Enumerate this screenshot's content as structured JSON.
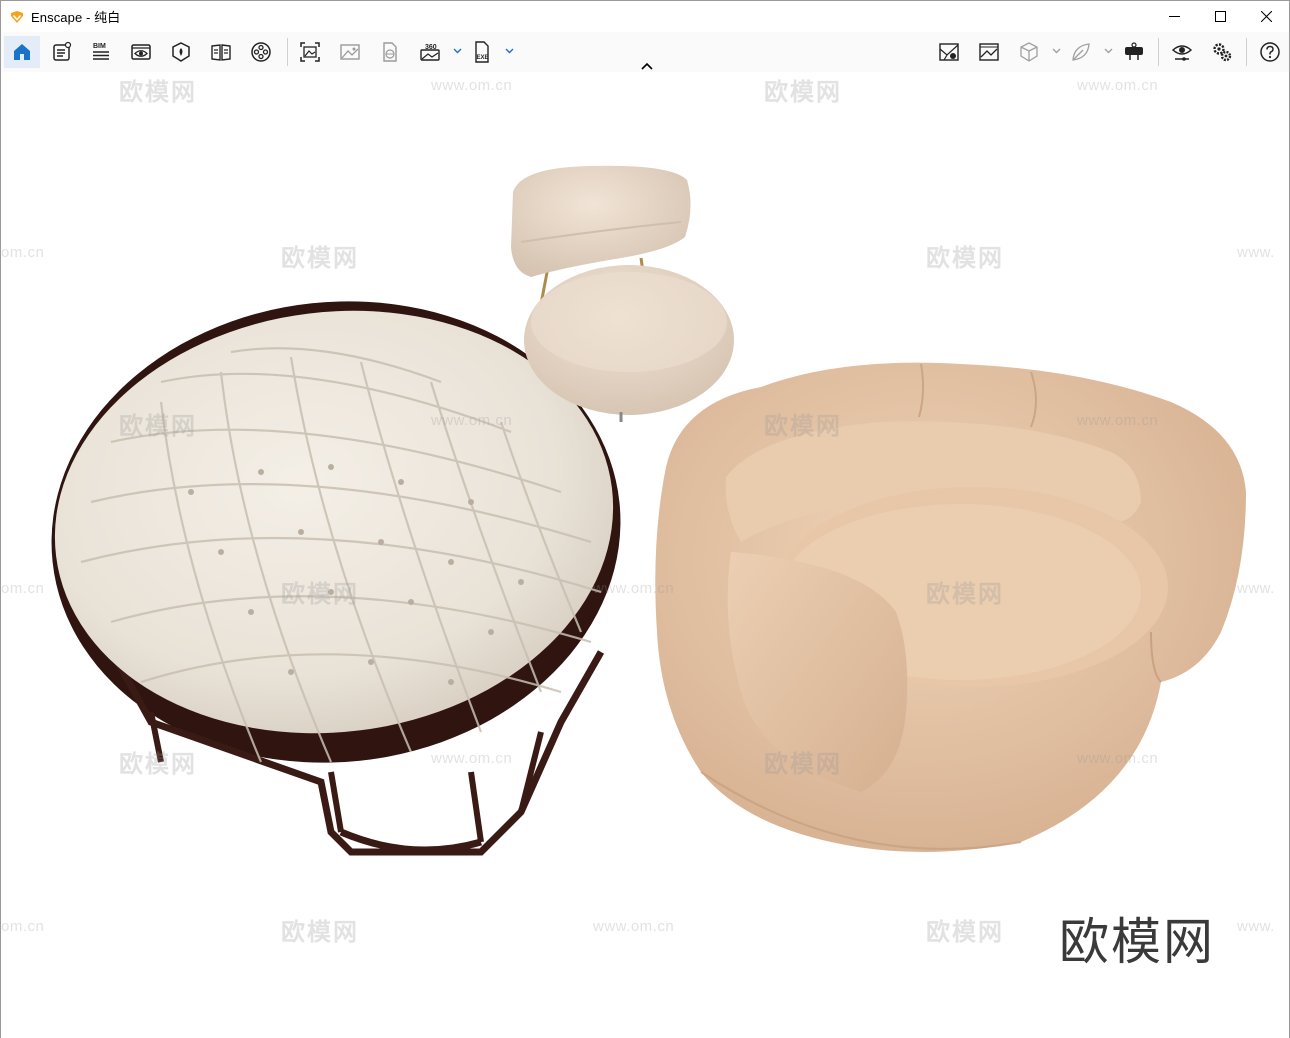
{
  "window": {
    "title": "Enscape - 纯白"
  },
  "toolbar": {
    "bim_label": "BIM",
    "pano_label": "360",
    "exe_label": "EXE"
  },
  "watermark": {
    "brand": "欧模网",
    "url": "www.om.cn",
    "url_fragment_left": "om.cn",
    "url_fragment_right": "www.",
    "big_logo": "欧模网"
  },
  "colors": {
    "accent": "#1a73c8",
    "papasan_cushion": "#ece6dc",
    "papasan_frame": "#3a1a14",
    "lounge_chair": "#ead7c3",
    "barrel_chair": "#e3c2a4"
  },
  "icons": {
    "home": "home-icon",
    "project_info": "project-info-icon",
    "bim": "bim-icon",
    "views": "views-icon",
    "assets": "asset-library-icon",
    "book": "batch-render-icon",
    "video": "video-editor-icon",
    "screenshot": "screenshot-icon",
    "render_image": "render-image-icon",
    "web_export": "web-standalone-icon",
    "panorama": "panorama-360-icon",
    "exe": "exe-export-icon",
    "map": "site-context-icon",
    "vr": "vr-headset-icon",
    "visual_settings": "visual-settings-icon",
    "settings": "settings-gears-icon",
    "help": "help-icon"
  }
}
